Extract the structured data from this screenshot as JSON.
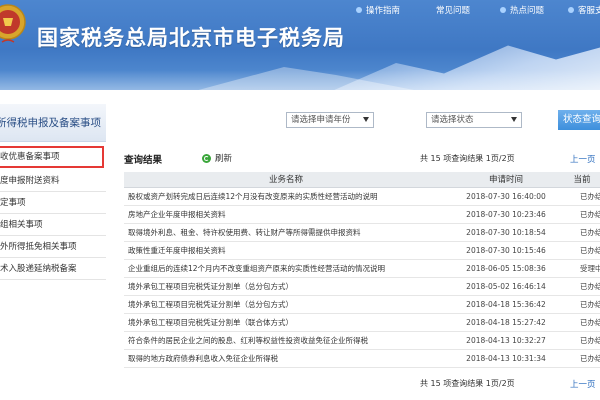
{
  "header": {
    "title": "国家税务总局北京市电子税务局",
    "nav": [
      {
        "label": "操作指南"
      },
      {
        "label": "常见问题"
      },
      {
        "label": "热点问题"
      },
      {
        "label": "客服支持"
      }
    ]
  },
  "sidebar": {
    "heading": "所得税申报及备案事项",
    "items": [
      {
        "label": "收优惠备案事项",
        "active": true
      },
      {
        "label": "度申报附送资料",
        "active": false
      },
      {
        "label": "定事项",
        "active": false
      },
      {
        "label": "组相关事项",
        "active": false
      },
      {
        "label": "外所得抵免相关事项",
        "active": false
      },
      {
        "label": "术入股递延纳税备案",
        "active": false
      }
    ]
  },
  "filters": {
    "year_select": "请选择申请年份",
    "status_select": "请选择状态",
    "query_button": "状态查询"
  },
  "results": {
    "title": "查询结果",
    "refresh_label": "刷新",
    "paging_text": "共 15 项查询结果 1页/2页",
    "prev_label": "上一页",
    "columns": [
      "业务名称",
      "申请时间",
      "当前"
    ],
    "rows": [
      {
        "name": "股权或资产划转完成日后连续12个月没有改变原来的实质性经营活动的说明",
        "time": "2018-07-30 16:40:00",
        "status": "已办结"
      },
      {
        "name": "房地产企业年度申报相关资料",
        "time": "2018-07-30 10:23:46",
        "status": "已办结"
      },
      {
        "name": "取得境外利息、租金、特许权使用费、转让财产等所得需提供申报资料",
        "time": "2018-07-30 10:18:54",
        "status": "已办结"
      },
      {
        "name": "政策性重迁年度申报相关资料",
        "time": "2018-07-30 10:15:46",
        "status": "已办结"
      },
      {
        "name": "企业重组后的连续12个月内不改变重组资产原来的实质性经营活动的情况说明",
        "time": "2018-06-05 15:08:36",
        "status": "受理中"
      },
      {
        "name": "境外承包工程项目完税凭证分割单（总分包方式）",
        "time": "2018-05-02 16:46:14",
        "status": "已办结"
      },
      {
        "name": "境外承包工程项目完税凭证分割单（总分包方式）",
        "time": "2018-04-18 15:36:42",
        "status": "已办结"
      },
      {
        "name": "境外承包工程项目完税凭证分割单（联合体方式）",
        "time": "2018-04-18 15:27:42",
        "status": "已办结"
      },
      {
        "name": "符合条件的居民企业之间的股息、红利等权益性投资收益免征企业所得税",
        "time": "2018-04-13 10:32:27",
        "status": "已办结"
      },
      {
        "name": "取得的地方政府债券利息收入免征企业所得税",
        "time": "2018-04-13 10:31:34",
        "status": "已办结"
      }
    ]
  },
  "colors": {
    "header_blue": "#3f78c4",
    "link_blue": "#2f6fbf",
    "active_border": "#e53935",
    "query_button": "#3d8fdc"
  },
  "icons": {
    "emblem": "tax-emblem-icon",
    "nav_dot": "bullet-dot-icon",
    "refresh": "refresh-icon",
    "dropdown": "dropdown-arrow-icon"
  }
}
